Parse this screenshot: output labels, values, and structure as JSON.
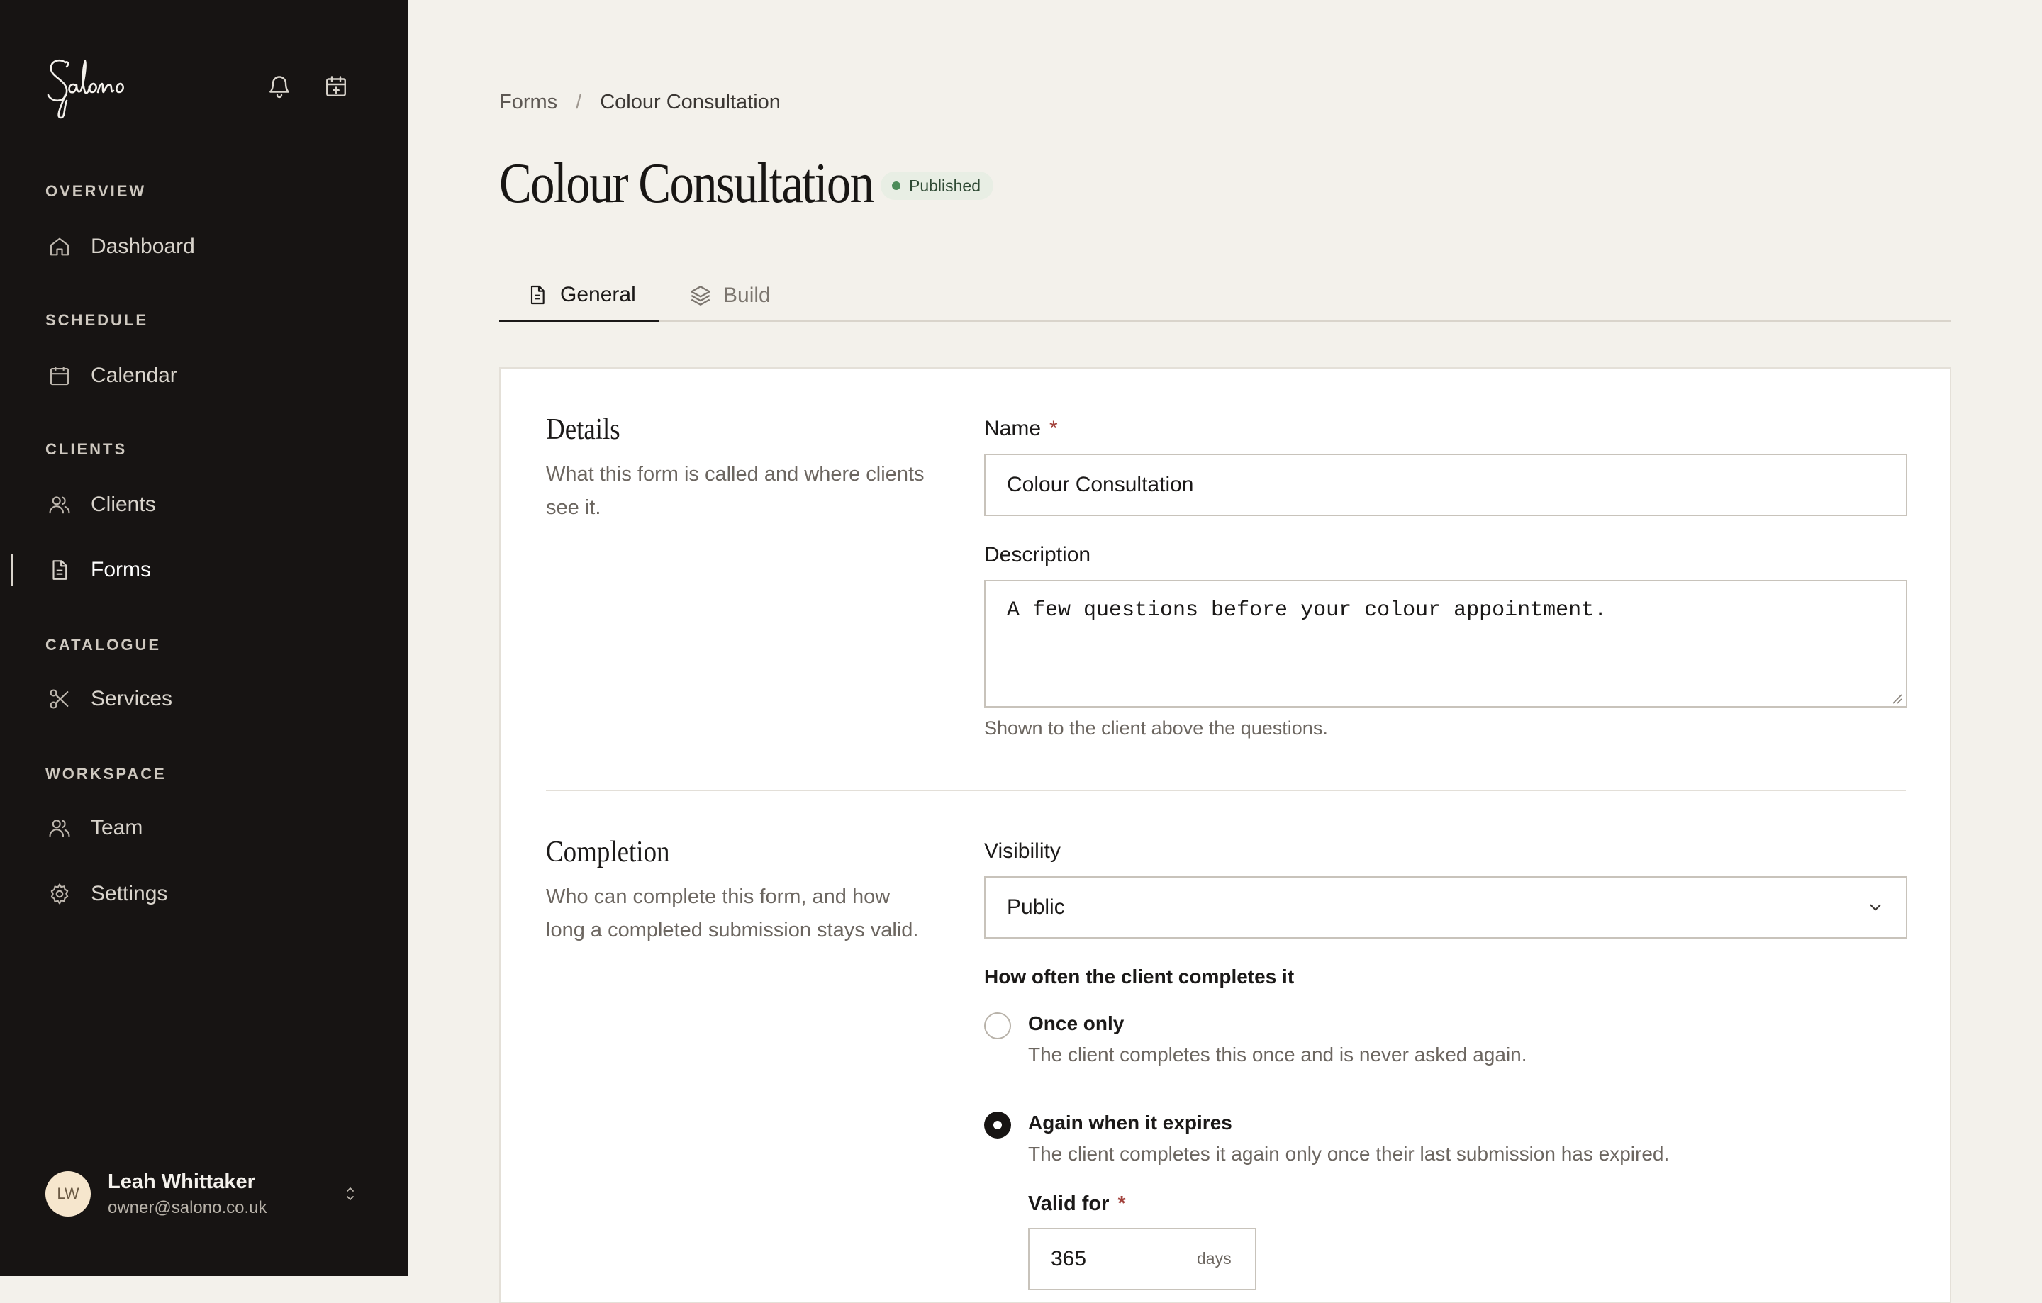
{
  "app": {
    "name": "Salono"
  },
  "header_icons": [
    "bell-icon",
    "calendar-plus-icon"
  ],
  "sidebar": {
    "sections": [
      {
        "label": "OVERVIEW",
        "items": [
          {
            "label": "Dashboard",
            "icon": "home-icon"
          }
        ]
      },
      {
        "label": "SCHEDULE",
        "items": [
          {
            "label": "Calendar",
            "icon": "calendar-icon"
          }
        ]
      },
      {
        "label": "CLIENTS",
        "items": [
          {
            "label": "Clients",
            "icon": "users-icon"
          },
          {
            "label": "Forms",
            "icon": "document-icon",
            "active": true
          }
        ]
      },
      {
        "label": "CATALOGUE",
        "items": [
          {
            "label": "Services",
            "icon": "scissors-icon"
          }
        ]
      },
      {
        "label": "WORKSPACE",
        "items": [
          {
            "label": "Team",
            "icon": "users-icon"
          },
          {
            "label": "Settings",
            "icon": "gear-icon"
          }
        ]
      }
    ],
    "user": {
      "initials": "LW",
      "name": "Leah Whittaker",
      "email": "owner@salono.co.uk"
    }
  },
  "breadcrumb": {
    "parent": "Forms",
    "separator": "/",
    "current": "Colour Consultation"
  },
  "page": {
    "title": "Colour Consultation",
    "status": "Published"
  },
  "tabs": [
    {
      "label": "General",
      "active": true
    },
    {
      "label": "Build",
      "active": false
    }
  ],
  "details": {
    "title": "Details",
    "description": "What this form is called and where clients see it.",
    "name_label": "Name",
    "required_mark": "*",
    "name_value": "Colour Consultation",
    "description_label": "Description",
    "description_value": "A few questions before your colour appointment.",
    "description_hint": "Shown to the client above the questions."
  },
  "completion": {
    "title": "Completion",
    "description": "Who can complete this form, and how long a completed submission stays valid.",
    "visibility_label": "Visibility",
    "visibility_value": "Public",
    "frequency_label": "How often the client completes it",
    "options": [
      {
        "title": "Once only",
        "desc": "The client completes this once and is never asked again.",
        "selected": false
      },
      {
        "title": "Again when it expires",
        "desc": "The client completes it again only once their last submission has expired.",
        "selected": true
      }
    ],
    "valid_for_label": "Valid for",
    "valid_for_value": "365",
    "valid_for_unit": "days"
  },
  "colors": {
    "sidebar_bg": "#171413",
    "page_bg": "#f3f1eb",
    "badge_bg": "#e8eee4",
    "badge_dot": "#4d8c5a",
    "required": "#a2413b"
  }
}
